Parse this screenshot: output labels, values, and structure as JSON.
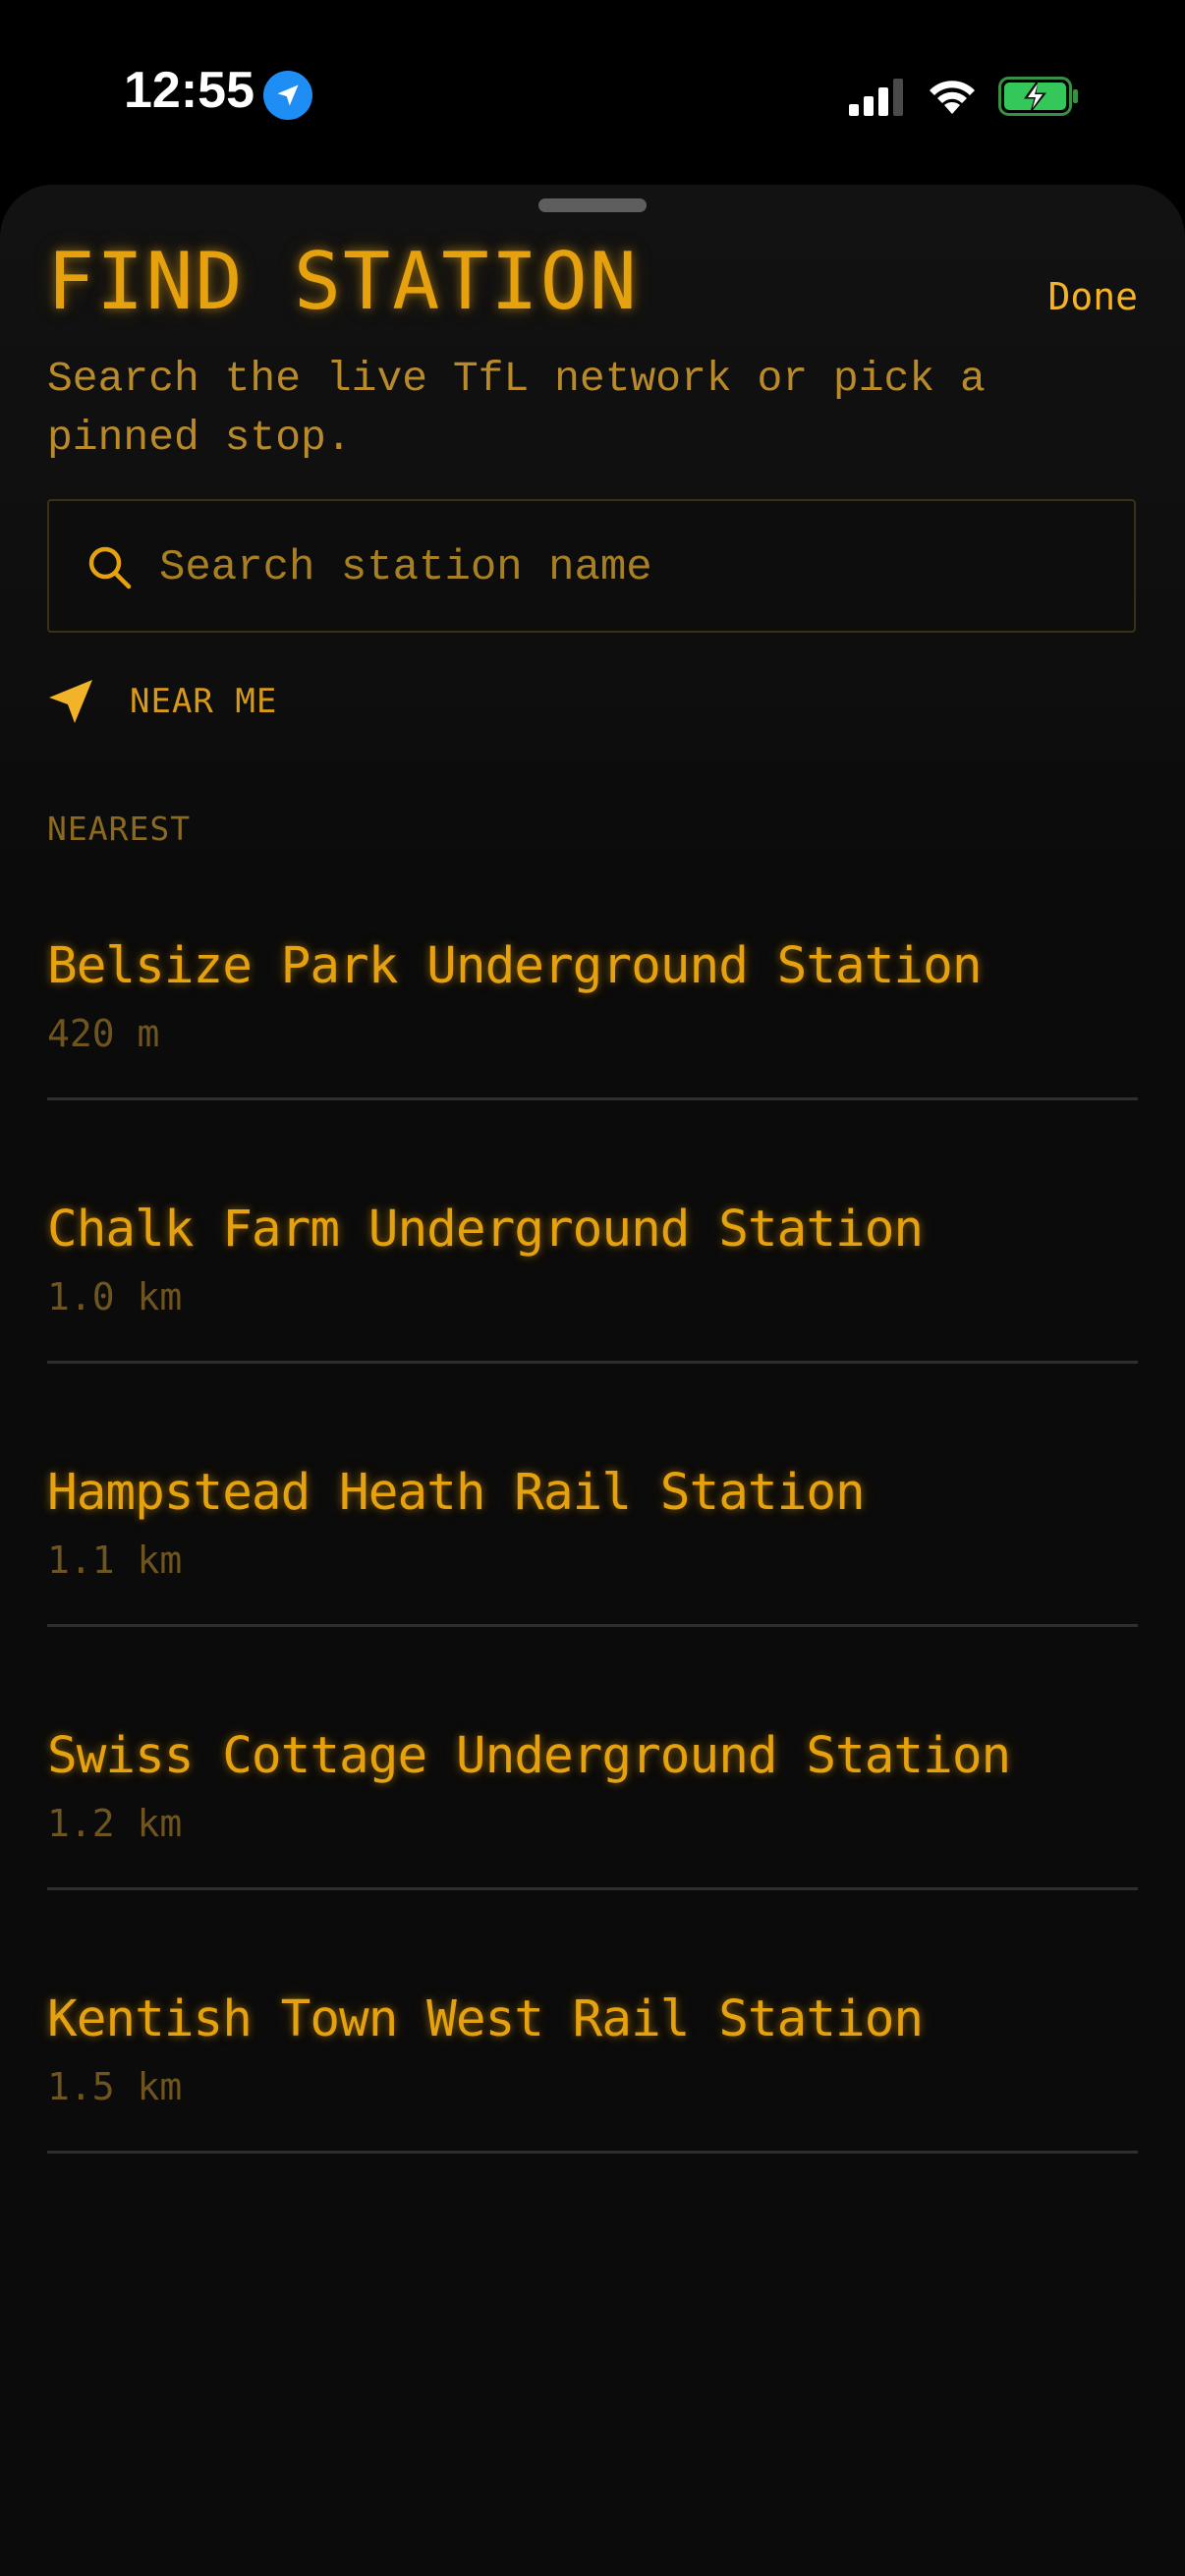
{
  "status_bar": {
    "time": "12:55"
  },
  "sheet": {
    "title": "FIND STATION",
    "done_label": "Done",
    "subtitle": "Search the live TfL network or pick a pinned stop.",
    "search": {
      "placeholder": "Search station name",
      "value": ""
    },
    "near_me_label": "NEAR ME",
    "section_header": "NEAREST",
    "stations": [
      {
        "name": "Belsize Park Underground Station",
        "distance": "420 m"
      },
      {
        "name": "Chalk Farm Underground Station",
        "distance": "1.0 km"
      },
      {
        "name": "Hampstead Heath Rail Station",
        "distance": "1.1 km"
      },
      {
        "name": "Swiss Cottage Underground Station",
        "distance": "1.2 km"
      },
      {
        "name": "Kentish Town West Rail Station",
        "distance": "1.5 km"
      }
    ]
  },
  "icons": {
    "location_badge": "location-arrow-icon",
    "signal": "cellular-signal-icon",
    "wifi": "wifi-icon",
    "battery": "battery-charging-icon",
    "search": "search-icon",
    "near_me": "location-arrow-icon"
  },
  "colors": {
    "accent": "#e6a20e",
    "background": "#0b0b0b",
    "distance_text": "#6e5520",
    "section_header": "#8a6a20",
    "location_badge": "#1e8ef5",
    "battery_green": "#34c759"
  }
}
